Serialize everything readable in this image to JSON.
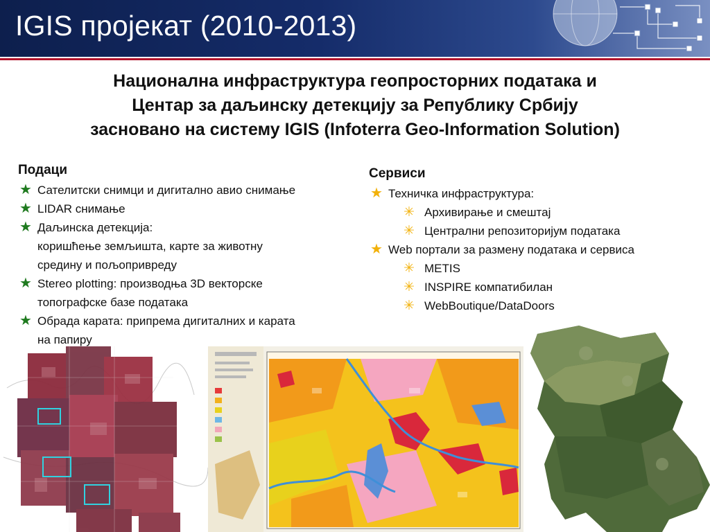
{
  "title": "IGIS пројекат (2010-2013)",
  "subtitle": [
    "Национална инфраструктура геопросторних података и",
    "Центар за даљинску детекцију за Републику Србију",
    "засновано на систему IGIS (Infoterra Geo-Information Solution)"
  ],
  "data_section": {
    "heading": "Подаци",
    "items": [
      "Сателитски снимци и дигитално авио снимање",
      "LIDAR снимање",
      "Даљинска детекција:",
      "коришћење земљишта,  карте  за животну",
      "средину и пољопривреду",
      "Stereo plotting: производња 3D векторске",
      "топографске базе података",
      "Обрада карата: припрема дигиталних и карата",
      "на папиру"
    ]
  },
  "services_section": {
    "heading": "Сервиси",
    "items": [
      "Техничка инфраструктура:",
      "Архивирање и смештај",
      "Централни репозиторијум података",
      "Web портали за размену података и сервиса",
      "METIS",
      "INSPIRE компатибилан",
      "WebBoutique/DataDoors"
    ]
  },
  "icons": {
    "data_bullet": "green-star-icon",
    "service_bullet": "gold-star-icon",
    "sub_bullet": "gold-asterisk-icon"
  },
  "colors": {
    "header_bg": "#152c6a",
    "accent_line": "#b0122a",
    "green_star": "#1f7a1f",
    "gold_star": "#f2b10a"
  }
}
